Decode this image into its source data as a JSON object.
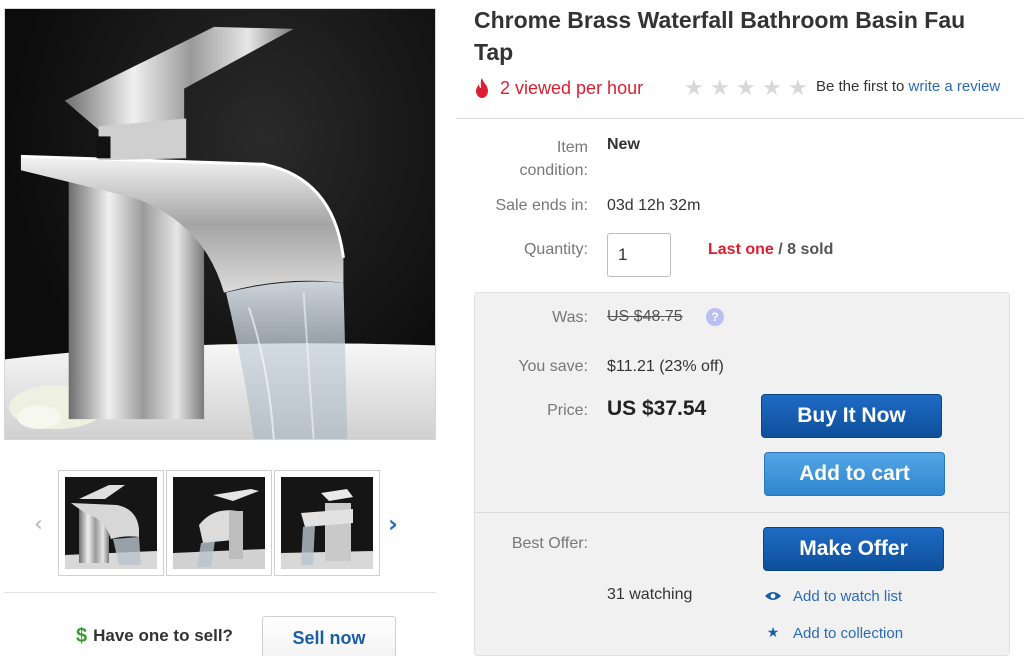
{
  "listing": {
    "title_line1": "Chrome Brass Waterfall Bathroom Basin Fau",
    "title_line2": "Tap",
    "viewed_text": "2 viewed per hour",
    "rating_stars": 0,
    "review_prefix": "Be the first to",
    "review_link": "write a review"
  },
  "details": {
    "condition_label_line1": "Item",
    "condition_label_line2": "condition:",
    "condition_value": "New",
    "sale_ends_label": "Sale ends in:",
    "sale_ends_value": "03d 12h 32m",
    "quantity_label": "Quantity:",
    "quantity_value": "1",
    "last_one": "Last one",
    "sold_text": "/ 8 sold"
  },
  "pricing": {
    "was_label": "Was:",
    "was_value": "US $48.75",
    "info_icon": "?",
    "save_label": "You save:",
    "save_value": "$11.21 (23% off)",
    "price_label": "Price:",
    "price_value": "US $37.54",
    "buy_now": "Buy It Now",
    "add_to_cart": "Add to cart",
    "best_offer_label": "Best Offer:",
    "make_offer": "Make Offer",
    "watching": "31 watching",
    "add_watch_list": "Add to watch list",
    "add_collection": "Add to collection"
  },
  "gallery": {
    "prev_arrow": "‹",
    "next_arrow": "›",
    "thumbnails": [
      "faucet-front",
      "faucet-angle",
      "faucet-side"
    ]
  },
  "sell": {
    "dollar_icon": "$",
    "prompt": "Have one to sell?",
    "button": "Sell now"
  },
  "colors": {
    "accent_blue": "#0e4f9b",
    "light_blue": "#2e86cf",
    "link_blue": "#2b6bb8",
    "alert_red": "#dd1e31",
    "sell_green": "#3a9b2e"
  }
}
